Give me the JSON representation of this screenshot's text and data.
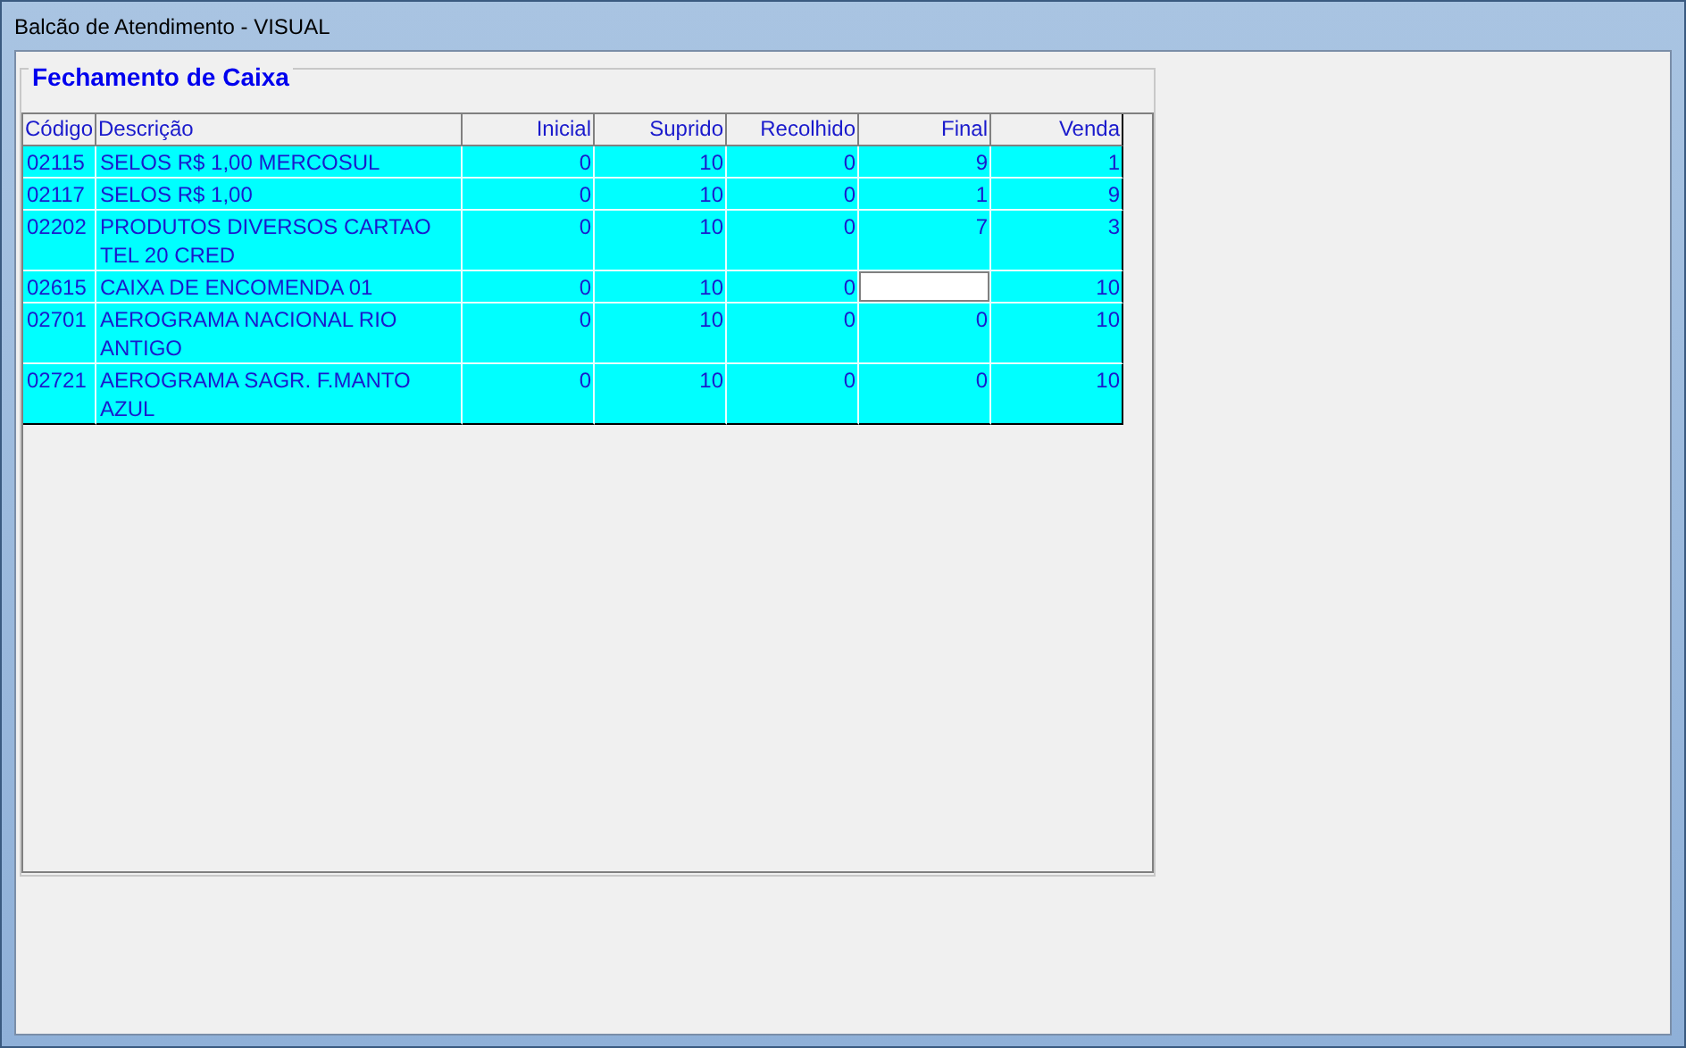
{
  "window": {
    "title": "Balcão de Atendimento - VISUAL"
  },
  "group": {
    "title": "Fechamento de Caixa"
  },
  "table": {
    "columns": [
      "Código",
      "Descrição",
      "Inicial",
      "Suprido",
      "Recolhido",
      "Final",
      "Venda"
    ],
    "rows": [
      {
        "cells": [
          "02115",
          "SELOS R$ 1,00 MERCOSUL",
          "0",
          "10",
          "0",
          "9",
          "1"
        ],
        "editing": false
      },
      {
        "cells": [
          "02117",
          "SELOS R$ 1,00",
          "0",
          "10",
          "0",
          "1",
          "9"
        ],
        "editing": false
      },
      {
        "cells": [
          "02202",
          "PRODUTOS DIVERSOS CARTAO TEL 20 CRED",
          "0",
          "10",
          "0",
          "7",
          "3"
        ],
        "editing": false
      },
      {
        "cells": [
          "02615",
          "CAIXA DE ENCOMENDA 01",
          "0",
          "10",
          "0",
          null,
          "10"
        ],
        "editing": true
      },
      {
        "cells": [
          "02701",
          "AEROGRAMA NACIONAL RIO ANTIGO",
          "0",
          "10",
          "0",
          "0",
          "10"
        ],
        "editing": false
      },
      {
        "cells": [
          "02721",
          "AEROGRAMA SAGR. F.MANTO AZUL",
          "0",
          "10",
          "0",
          "0",
          "10"
        ],
        "editing": false
      }
    ]
  }
}
